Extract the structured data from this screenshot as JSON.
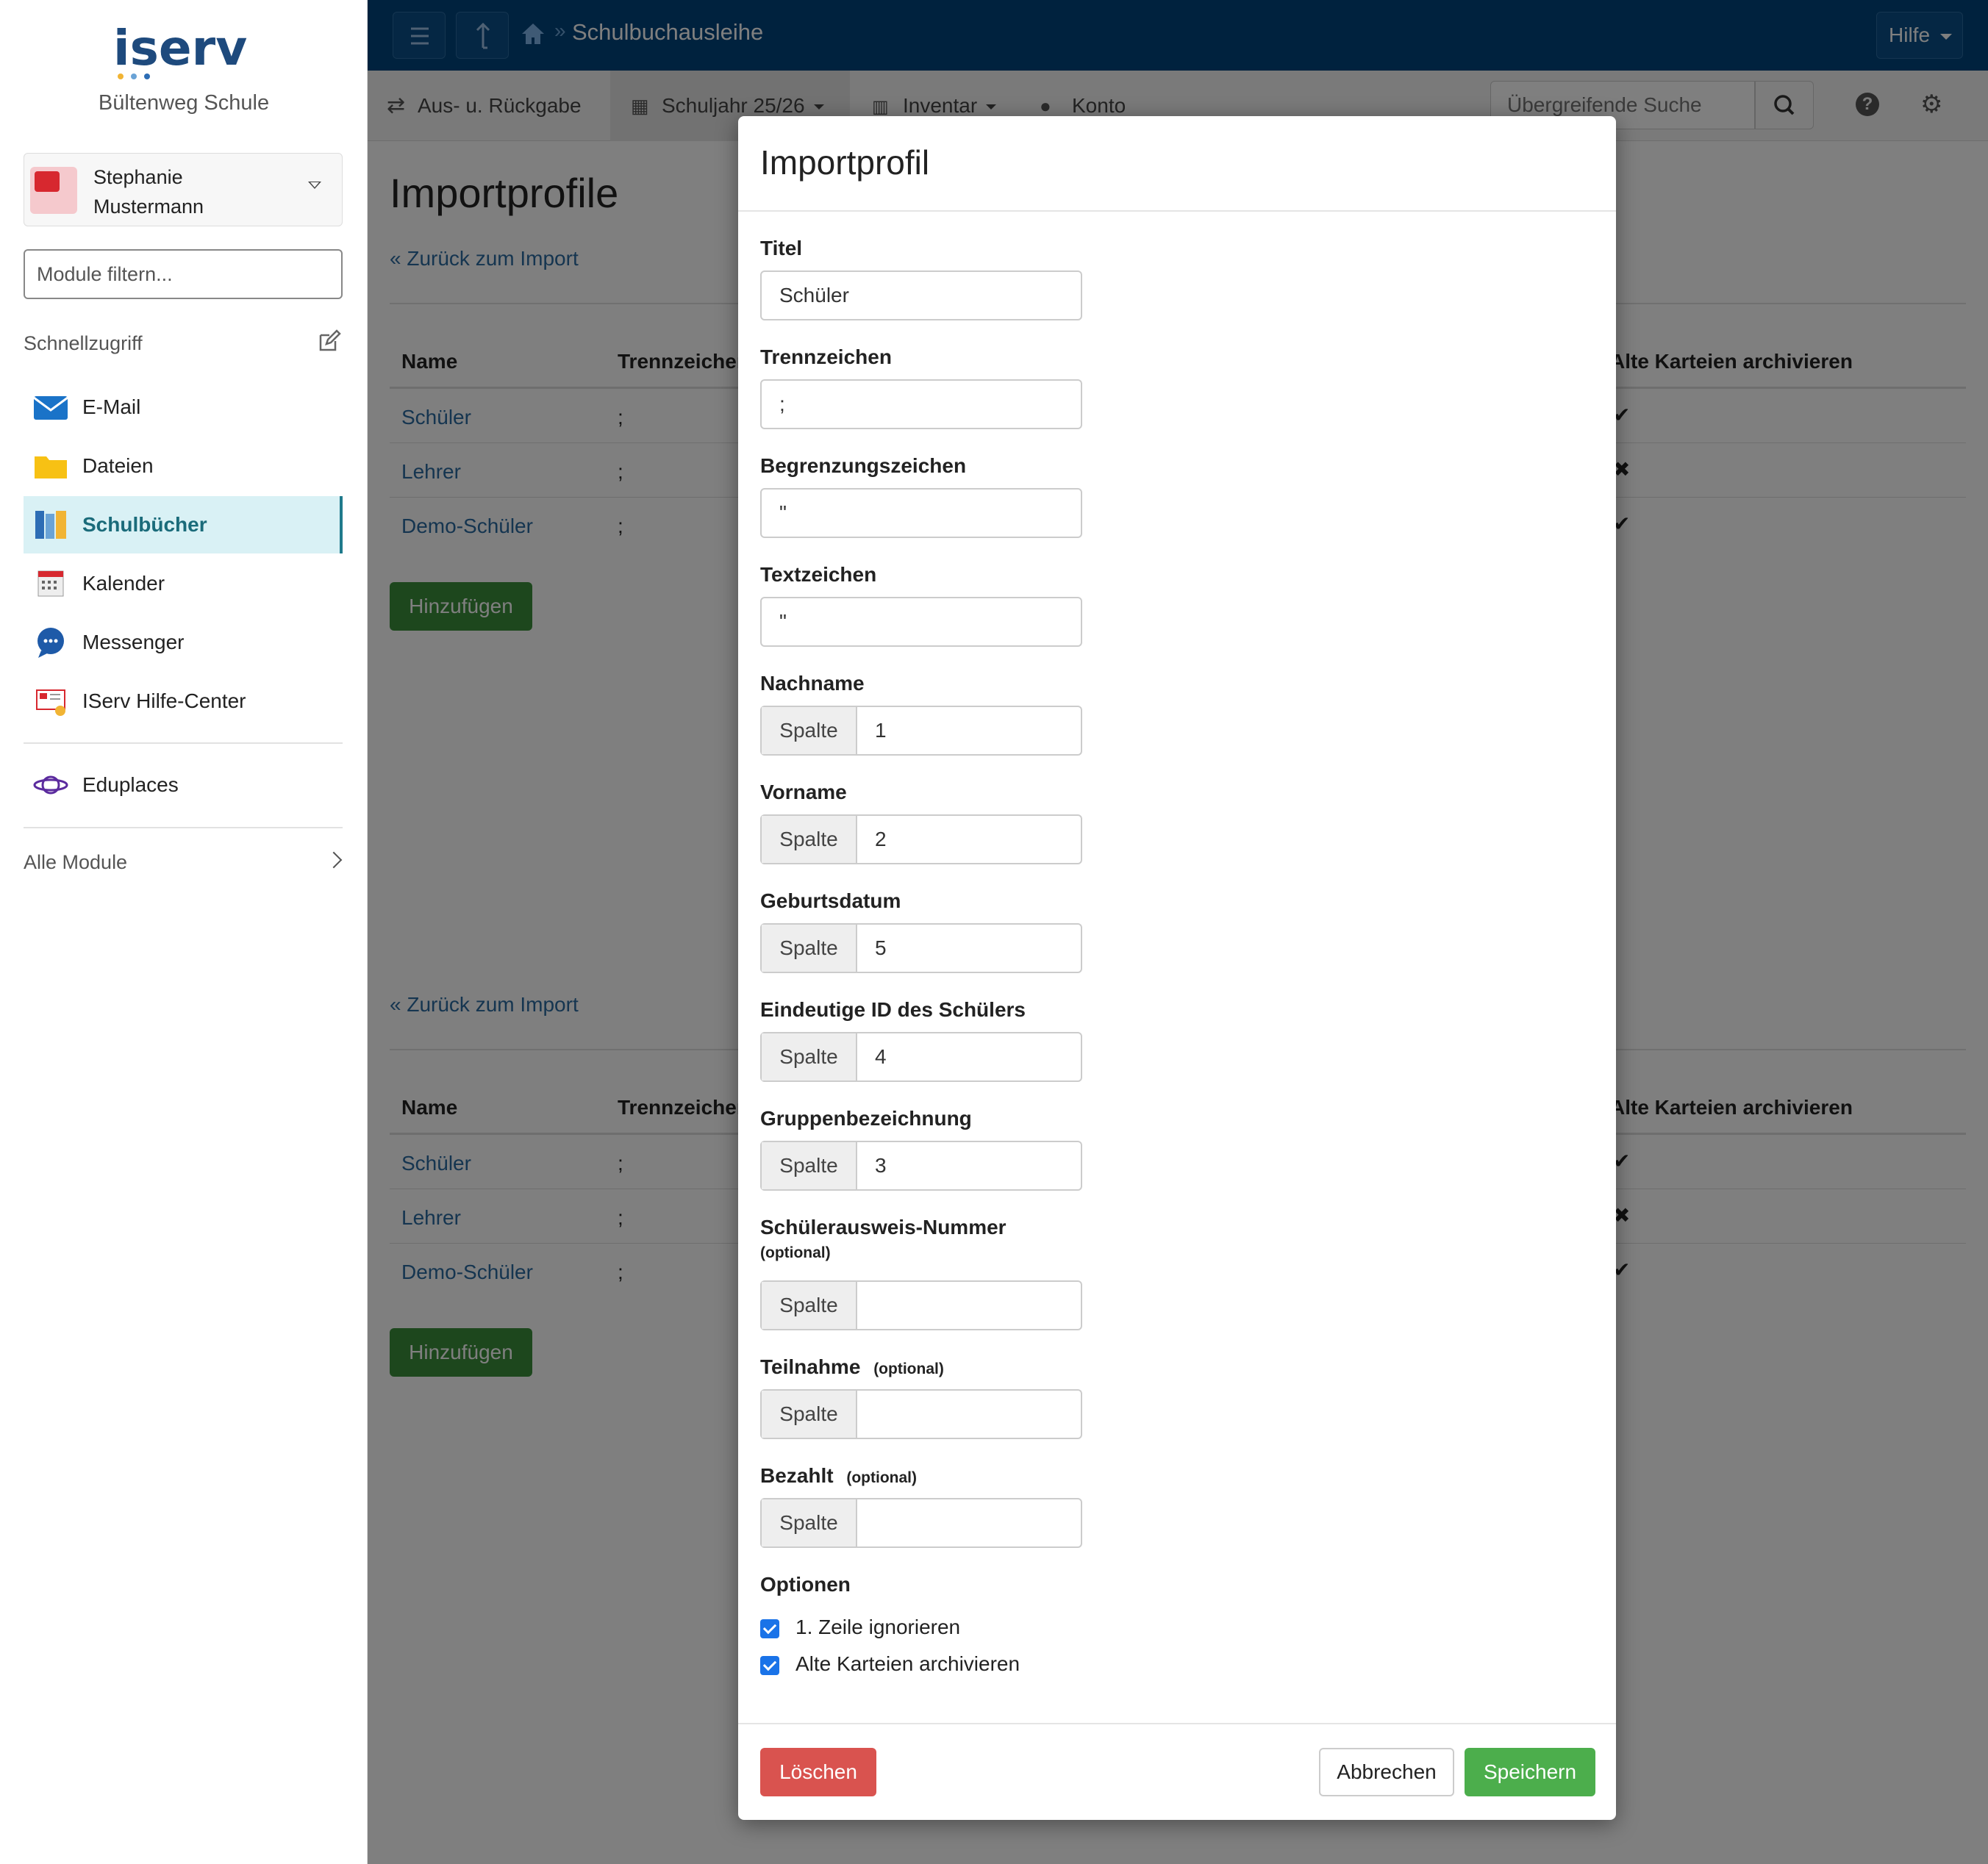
{
  "sidebar": {
    "logo_text": "iserv",
    "school": "Bültenweg Schule",
    "user": "Stephanie Mustermann",
    "filter_placeholder": "Module filtern...",
    "quick_access": "Schnellzugriff",
    "items": [
      {
        "label": "E-Mail",
        "icon": "mail-icon"
      },
      {
        "label": "Dateien",
        "icon": "folder-icon"
      },
      {
        "label": "Schulbücher",
        "icon": "books-icon",
        "active": true
      },
      {
        "label": "Kalender",
        "icon": "calendar-icon"
      },
      {
        "label": "Messenger",
        "icon": "chat-icon"
      },
      {
        "label": "IServ Hilfe-Center",
        "icon": "help-center-icon"
      },
      {
        "label": "Eduplaces",
        "icon": "planet-icon"
      }
    ],
    "all_modules": "Alle Module"
  },
  "topbar": {
    "title": "Schulbuchausleihe",
    "help": "Hilfe"
  },
  "subnav": {
    "items": [
      "Aus- u. Rückgabe",
      "Schuljahr 25/26",
      "Inventar",
      "Konto"
    ],
    "search_placeholder": "Übergreifende Suche"
  },
  "page": {
    "title": "Importprofile",
    "back_link": "« Zurück zum Import",
    "columns": [
      "Name",
      "Trennzeichen",
      "Alte Karteien archivieren"
    ],
    "rows": [
      {
        "name": "Schüler",
        "sep": ";",
        "archive": "✔"
      },
      {
        "name": "Lehrer",
        "sep": ";",
        "archive": "✖"
      },
      {
        "name": "Demo-Schüler",
        "sep": ";",
        "archive": "✔"
      }
    ],
    "add_button": "Hinzufügen"
  },
  "modal": {
    "title": "Importprofil",
    "fields": {
      "titel": {
        "label": "Titel",
        "value": "Schüler"
      },
      "trennzeichen": {
        "label": "Trennzeichen",
        "value": ";"
      },
      "begrenzung": {
        "label": "Begrenzungszeichen",
        "value": "\""
      },
      "text": {
        "label": "Textzeichen",
        "value": "\""
      },
      "nachname": {
        "label": "Nachname",
        "addon": "Spalte",
        "value": "1"
      },
      "vorname": {
        "label": "Vorname",
        "addon": "Spalte",
        "value": "2"
      },
      "geburtsdatum": {
        "label": "Geburtsdatum",
        "addon": "Spalte",
        "value": "5"
      },
      "id": {
        "label": "Eindeutige ID des Schülers",
        "addon": "Spalte",
        "value": "4"
      },
      "gruppe": {
        "label": "Gruppenbezeichnung",
        "addon": "Spalte",
        "value": "3"
      },
      "ausweis": {
        "label": "Schülerausweis-Nummer",
        "optional": "(optional)",
        "addon": "Spalte",
        "value": ""
      },
      "teilnahme": {
        "label": "Teilnahme",
        "optional": "(optional)",
        "addon": "Spalte",
        "value": ""
      },
      "bezahlt": {
        "label": "Bezahlt",
        "optional": "(optional)",
        "addon": "Spalte",
        "value": ""
      }
    },
    "options_label": "Optionen",
    "options": [
      "1. Zeile ignorieren",
      "Alte Karteien archivieren"
    ],
    "buttons": {
      "delete": "Löschen",
      "cancel": "Abbrechen",
      "save": "Speichern"
    }
  }
}
